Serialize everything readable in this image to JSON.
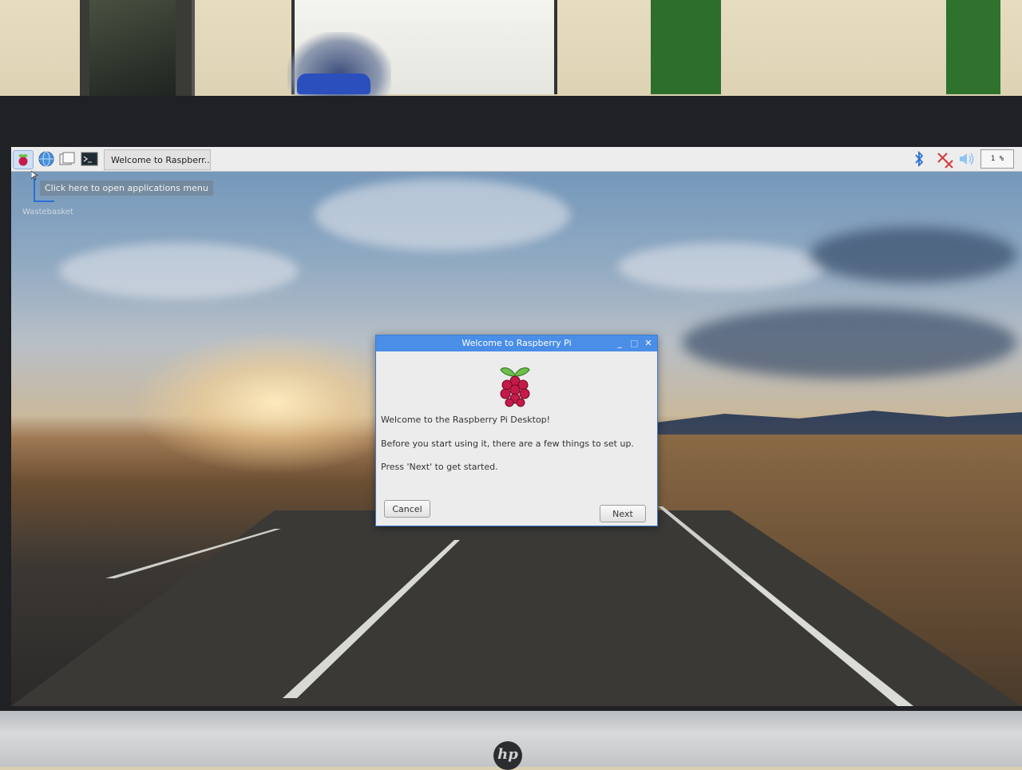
{
  "taskbar": {
    "menu_icon": "raspberry-menu-icon",
    "web_icon": "globe-icon",
    "files_icon": "file-manager-icon",
    "terminal_icon": "terminal-icon",
    "task_label": "Welcome to Raspberr...",
    "tray": {
      "bluetooth_icon": "bluetooth-icon",
      "network_icon": "network-disconnected-icon",
      "volume_icon": "volume-icon",
      "cpu_label": "1 %"
    }
  },
  "desktop": {
    "tooltip": "Click here to open applications menu",
    "wastebasket_label": "Wastebasket"
  },
  "dialog": {
    "title": "Welcome to Raspberry Pi",
    "minimize": "_",
    "maximize": "□",
    "close": "✕",
    "line1": "Welcome to the Raspberry Pi Desktop!",
    "line2": "Before you start using it, there are a few things to set up.",
    "line3": "Press 'Next' to get started.",
    "cancel_label": "Cancel",
    "next_label": "Next"
  },
  "monitor": {
    "brand": "hp"
  },
  "colors": {
    "titlebar": "#4a8ee8",
    "taskbar": "#ededed",
    "raspberry_red": "#c51a4a",
    "leaf_green": "#6cc04a"
  }
}
